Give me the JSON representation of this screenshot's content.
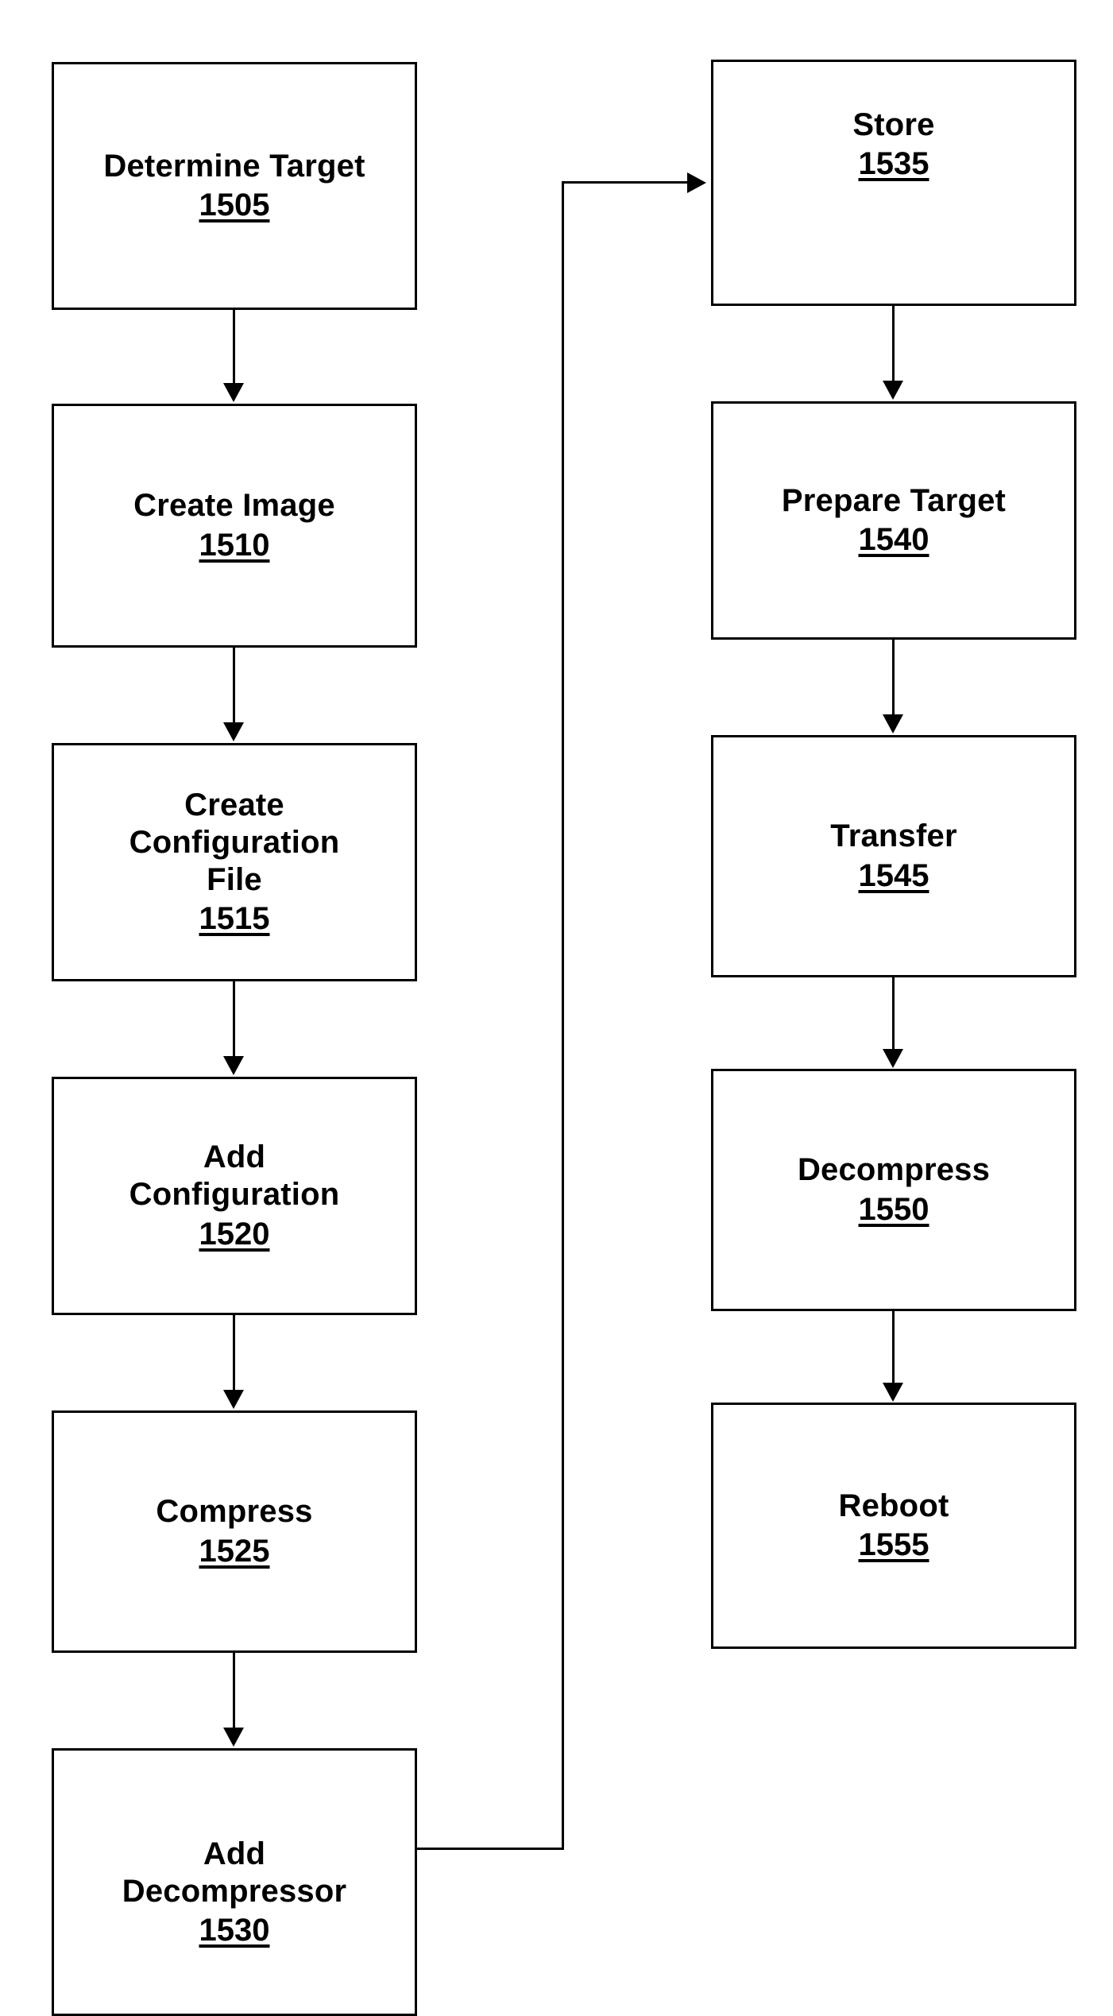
{
  "diagram": {
    "type": "flowchart",
    "orientation": "two-column-vertical",
    "background_color": "#ffffff",
    "line_color": "#000000",
    "columns": {
      "left": {
        "nodes": [
          {
            "label": "Determine Target",
            "ref": "1505"
          },
          {
            "label": "Create Image",
            "ref": "1510"
          },
          {
            "label": "Create\nConfiguration\nFile",
            "ref": "1515"
          },
          {
            "label": "Add\nConfiguration",
            "ref": "1520"
          },
          {
            "label": "Compress",
            "ref": "1525"
          },
          {
            "label": "Add\nDecompressor",
            "ref": "1530"
          }
        ]
      },
      "right": {
        "nodes": [
          {
            "label": "Store",
            "ref": "1535"
          },
          {
            "label": "Prepare Target",
            "ref": "1540"
          },
          {
            "label": "Transfer",
            "ref": "1545"
          },
          {
            "label": "Decompress",
            "ref": "1550"
          },
          {
            "label": "Reboot",
            "ref": "1555"
          }
        ]
      }
    },
    "edges": [
      {
        "from": "1505",
        "to": "1510",
        "style": "straight-down"
      },
      {
        "from": "1510",
        "to": "1515",
        "style": "straight-down"
      },
      {
        "from": "1515",
        "to": "1520",
        "style": "straight-down"
      },
      {
        "from": "1520",
        "to": "1525",
        "style": "straight-down"
      },
      {
        "from": "1525",
        "to": "1530",
        "style": "straight-down"
      },
      {
        "from": "1530",
        "to": "1535",
        "style": "right-up-right"
      },
      {
        "from": "1535",
        "to": "1540",
        "style": "straight-down"
      },
      {
        "from": "1540",
        "to": "1545",
        "style": "straight-down"
      },
      {
        "from": "1545",
        "to": "1550",
        "style": "straight-down"
      },
      {
        "from": "1550",
        "to": "1555",
        "style": "straight-down"
      }
    ]
  }
}
